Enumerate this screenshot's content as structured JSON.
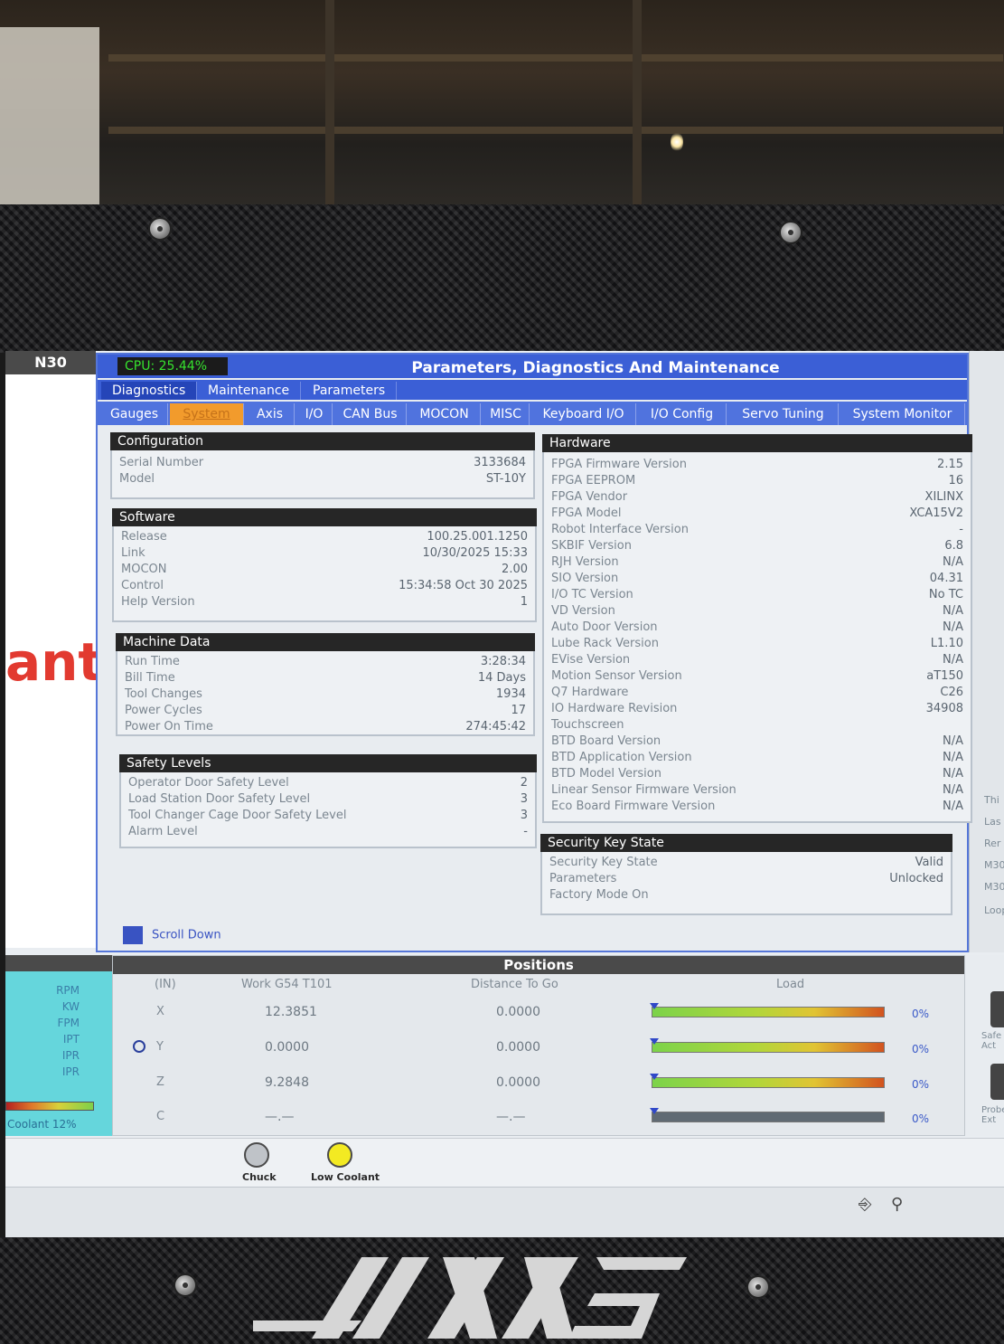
{
  "screen": {
    "line_indicator": "N30",
    "brand_fragment": "ant",
    "cpu": "CPU: 25.44%",
    "title": "Parameters, Diagnostics And Maintenance",
    "tabs_primary": [
      {
        "label": "Diagnostics",
        "active": true
      },
      {
        "label": "Maintenance",
        "active": false
      },
      {
        "label": "Parameters",
        "active": false
      }
    ],
    "tabs_secondary": [
      {
        "label": "Gauges",
        "active": false
      },
      {
        "label": "System",
        "active": true
      },
      {
        "label": "Axis",
        "active": false
      },
      {
        "label": "I/O",
        "active": false
      },
      {
        "label": "CAN Bus",
        "active": false
      },
      {
        "label": "MOCON",
        "active": false
      },
      {
        "label": "MISC",
        "active": false
      },
      {
        "label": "Keyboard I/O",
        "active": false
      },
      {
        "label": "I/O Config",
        "active": false
      },
      {
        "label": "Servo Tuning",
        "active": false
      },
      {
        "label": "System Monitor",
        "active": false
      }
    ],
    "configuration": {
      "title": "Configuration",
      "rows": [
        {
          "k": "Serial Number",
          "v": "3133684"
        },
        {
          "k": "Model",
          "v": "ST-10Y"
        }
      ]
    },
    "software": {
      "title": "Software",
      "rows": [
        {
          "k": "Release",
          "v": "100.25.001.1250"
        },
        {
          "k": "Link",
          "v": "10/30/2025 15:33"
        },
        {
          "k": "MOCON",
          "v": "2.00"
        },
        {
          "k": "Control",
          "v": "15:34:58  Oct 30 2025"
        },
        {
          "k": "Help Version",
          "v": "1"
        }
      ]
    },
    "machine_data": {
      "title": "Machine Data",
      "rows": [
        {
          "k": "Run Time",
          "v": "3:28:34"
        },
        {
          "k": "Bill Time",
          "v": "14 Days"
        },
        {
          "k": "Tool Changes",
          "v": "1934"
        },
        {
          "k": "Power Cycles",
          "v": "17"
        },
        {
          "k": "Power On Time",
          "v": "274:45:42"
        }
      ]
    },
    "safety_levels": {
      "title": "Safety Levels",
      "rows": [
        {
          "k": "Operator Door Safety Level",
          "v": "2"
        },
        {
          "k": "Load Station Door Safety Level",
          "v": "3"
        },
        {
          "k": "Tool Changer Cage Door Safety Level",
          "v": "3"
        },
        {
          "k": "Alarm Level",
          "v": "-"
        }
      ]
    },
    "hardware": {
      "title": "Hardware",
      "rows": [
        {
          "k": "FPGA Firmware Version",
          "v": "2.15"
        },
        {
          "k": "FPGA EEPROM",
          "v": "16"
        },
        {
          "k": "FPGA Vendor",
          "v": "XILINX"
        },
        {
          "k": "FPGA Model",
          "v": "XCA15V2"
        },
        {
          "k": "Robot Interface Version",
          "v": "-"
        },
        {
          "k": "SKBIF Version",
          "v": "6.8"
        },
        {
          "k": "RJH Version",
          "v": "N/A"
        },
        {
          "k": "SIO Version",
          "v": "04.31"
        },
        {
          "k": "I/O TC Version",
          "v": "No TC"
        },
        {
          "k": "VD Version",
          "v": "N/A"
        },
        {
          "k": "Auto Door Version",
          "v": "N/A"
        },
        {
          "k": "Lube Rack Version",
          "v": "L1.10"
        },
        {
          "k": "EVise Version",
          "v": "N/A"
        },
        {
          "k": "Motion Sensor Version",
          "v": "aT150"
        },
        {
          "k": "Q7 Hardware",
          "v": "C26"
        },
        {
          "k": "IO Hardware Revision",
          "v": "34908"
        },
        {
          "k": "Touchscreen",
          "v": ""
        },
        {
          "k": "BTD Board Version",
          "v": "N/A"
        },
        {
          "k": "BTD Application Version",
          "v": "N/A"
        },
        {
          "k": "BTD Model Version",
          "v": "N/A"
        },
        {
          "k": "Linear Sensor Firmware Version",
          "v": "N/A"
        },
        {
          "k": "Eco Board Firmware Version",
          "v": "N/A"
        }
      ]
    },
    "security_key": {
      "title": "Security Key State",
      "rows": [
        {
          "k": "Security Key State",
          "v": "Valid"
        },
        {
          "k": "Parameters",
          "v": "Unlocked"
        },
        {
          "k": "Factory Mode On",
          "v": ""
        }
      ]
    },
    "scroll_down": "Scroll Down",
    "left_units": [
      "RPM",
      "KW",
      "FPM",
      "IPT",
      "IPR",
      "IPR"
    ],
    "coolant": "Coolant  12%",
    "positions": {
      "title": "Positions",
      "head_unit": "(IN)",
      "head_work": "Work G54 T101",
      "head_dist": "Distance To Go",
      "head_load": "Load",
      "rows": [
        {
          "axis": "X",
          "work": "12.3851",
          "dist": "0.0000",
          "load": "0%",
          "load_fraction": 0.0,
          "bar": "grad"
        },
        {
          "axis": "Y",
          "work": "0.0000",
          "dist": "0.0000",
          "load": "0%",
          "load_fraction": 0.0,
          "bar": "grad"
        },
        {
          "axis": "Z",
          "work": "9.2848",
          "dist": "0.0000",
          "load": "0%",
          "load_fraction": 0.0,
          "bar": "grad"
        },
        {
          "axis": "C",
          "work": "—.—",
          "dist": "—.—",
          "load": "0%",
          "load_fraction": 0.0,
          "bar": "gray"
        }
      ]
    },
    "right_texts": [
      "Thi",
      "Las",
      "Rer",
      "M30",
      "M30",
      "Loop"
    ],
    "right_bottom": [
      "Safe Act",
      "Probe Ext"
    ],
    "status": {
      "chuck": "Chuck",
      "low_coolant": "Low Coolant"
    }
  },
  "colors": {
    "title_bar": "#3b5fd6",
    "active_tab": "#f29b2c",
    "cpu_text": "#36e22e",
    "brand_red": "#e23a30"
  }
}
